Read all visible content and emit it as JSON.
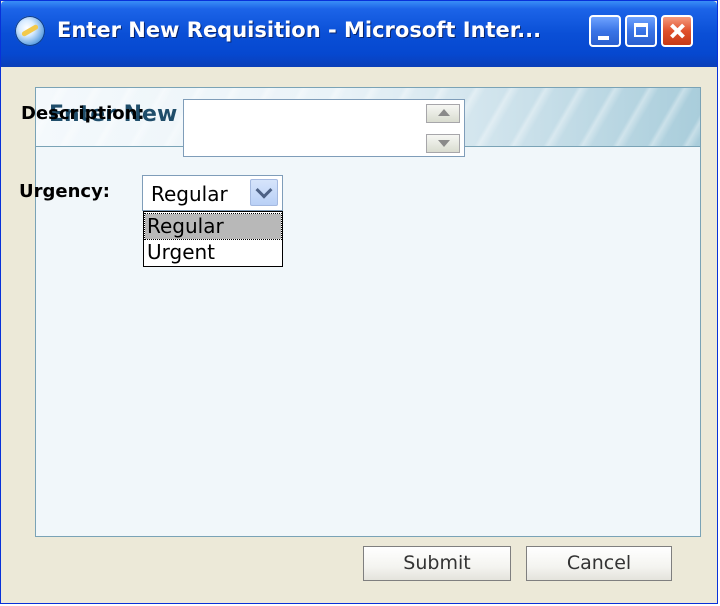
{
  "window": {
    "title": "Enter New Requisition - Microsoft Inter..."
  },
  "dialog": {
    "header": "Enter New Requisition",
    "description_label": "Description:",
    "description_value": "",
    "urgency_label": "Urgency:",
    "urgency_selected": "Regular",
    "urgency_options": [
      "Regular",
      "Urgent"
    ]
  },
  "buttons": {
    "submit": "Submit",
    "cancel": "Cancel"
  }
}
